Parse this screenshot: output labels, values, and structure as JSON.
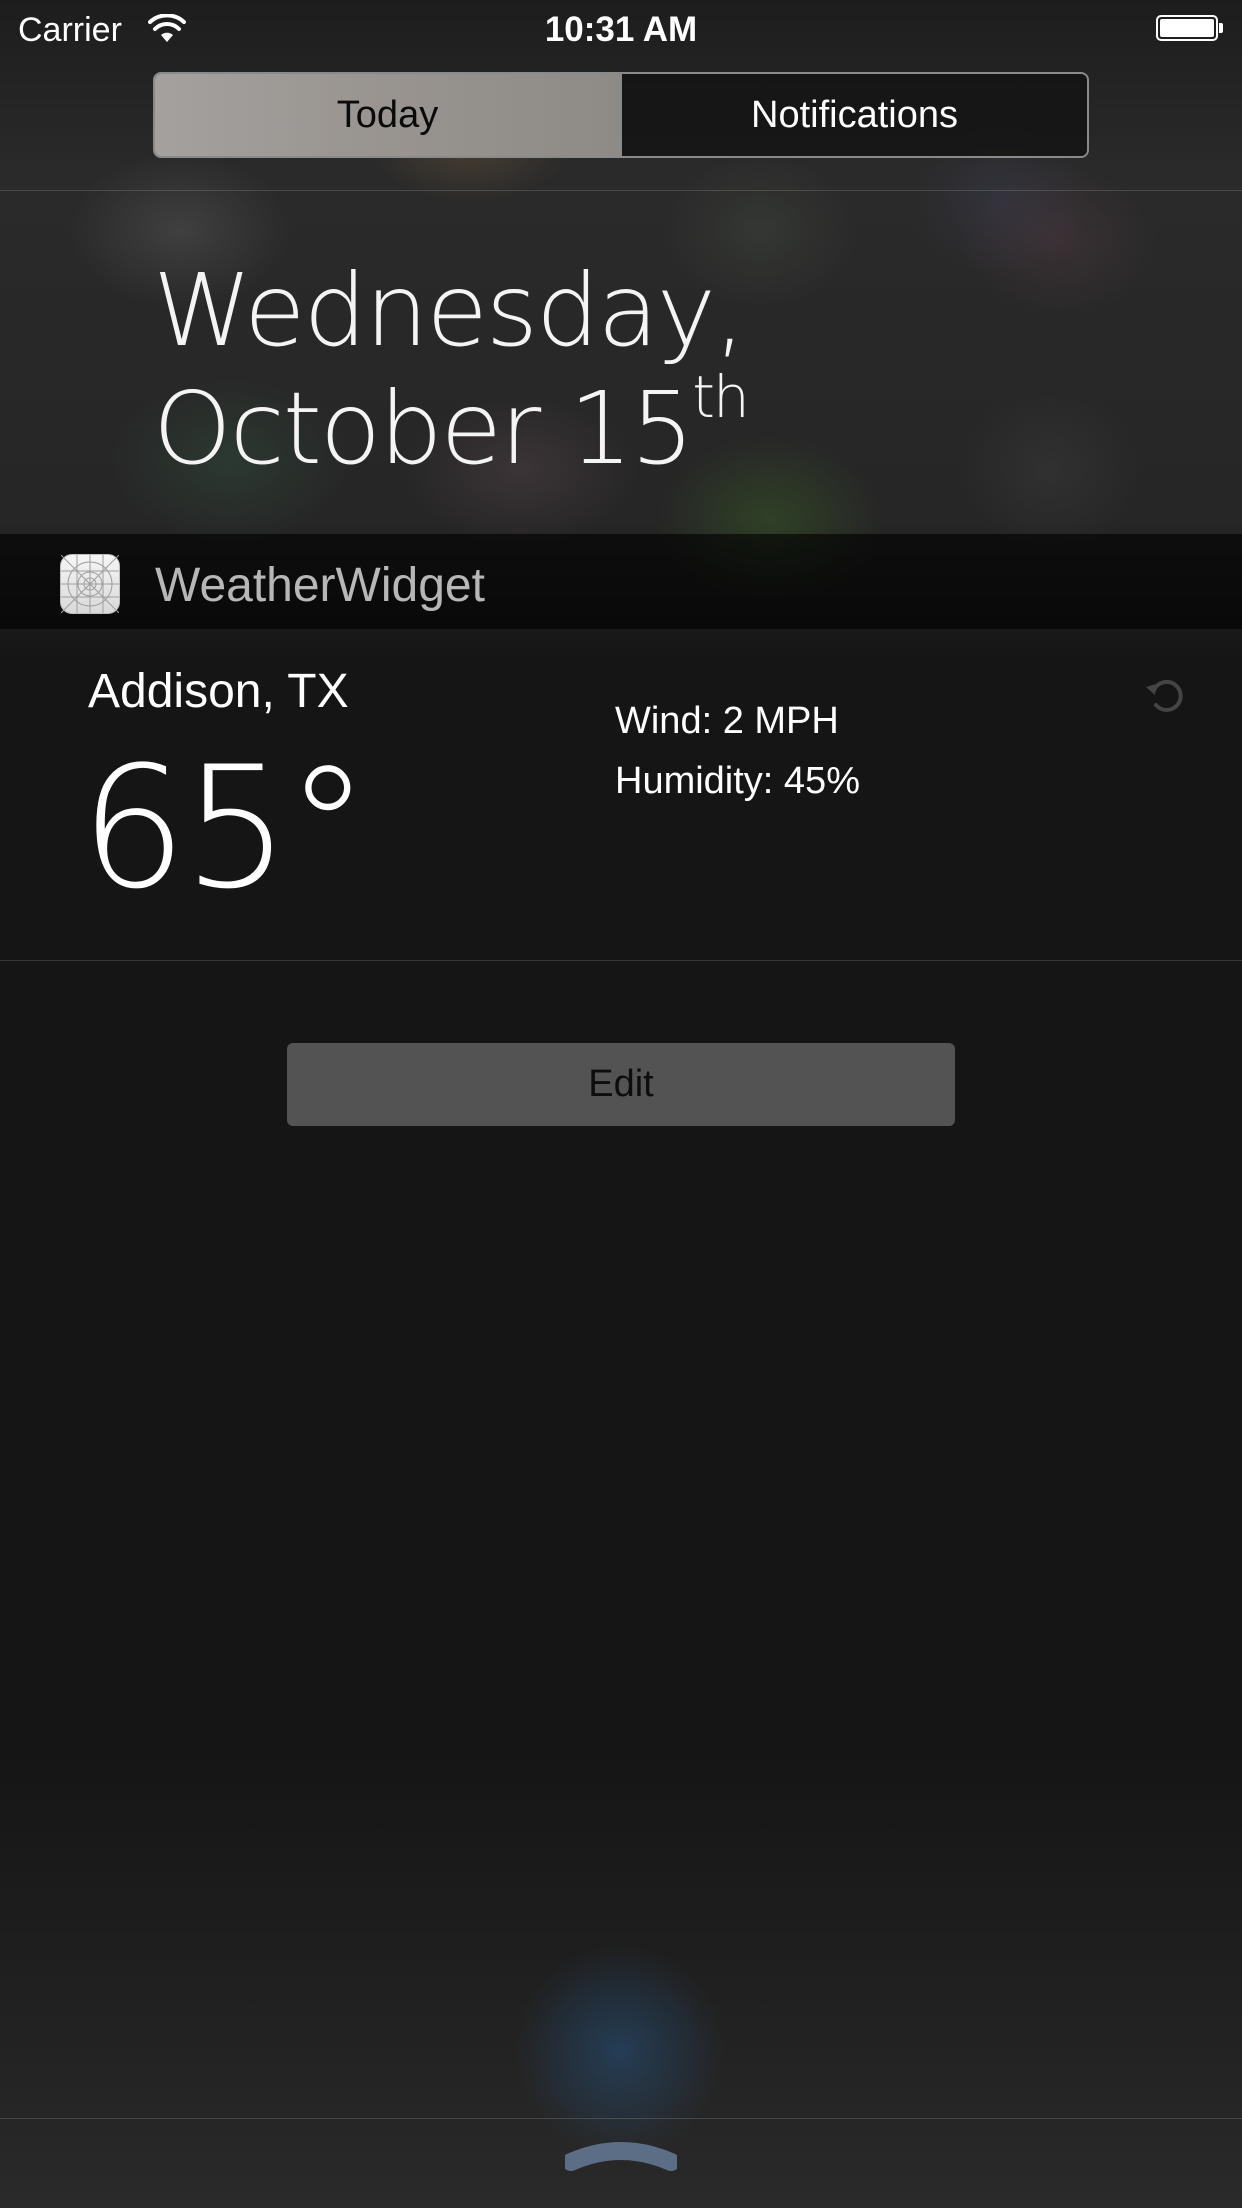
{
  "status_bar": {
    "carrier": "Carrier",
    "time": "10:31 AM",
    "battery_level": 1.0
  },
  "segmented_control": {
    "tabs": [
      {
        "label": "Today",
        "selected": true
      },
      {
        "label": "Notifications",
        "selected": false
      }
    ]
  },
  "date": {
    "line1": "Wednesday,",
    "line2": "October 15",
    "ordinal_suffix": "th"
  },
  "widget": {
    "app_name": "WeatherWidget",
    "location": "Addison, TX",
    "temperature": "65°",
    "wind": "Wind: 2 MPH",
    "humidity": "Humidity: 45%",
    "refresh_icon": "refresh-icon"
  },
  "edit_button": {
    "label": "Edit"
  },
  "colors": {
    "background": "#151515",
    "segment_selected": "#9b9692",
    "edit_button": "#535353",
    "grabber": "#5b6e86"
  }
}
